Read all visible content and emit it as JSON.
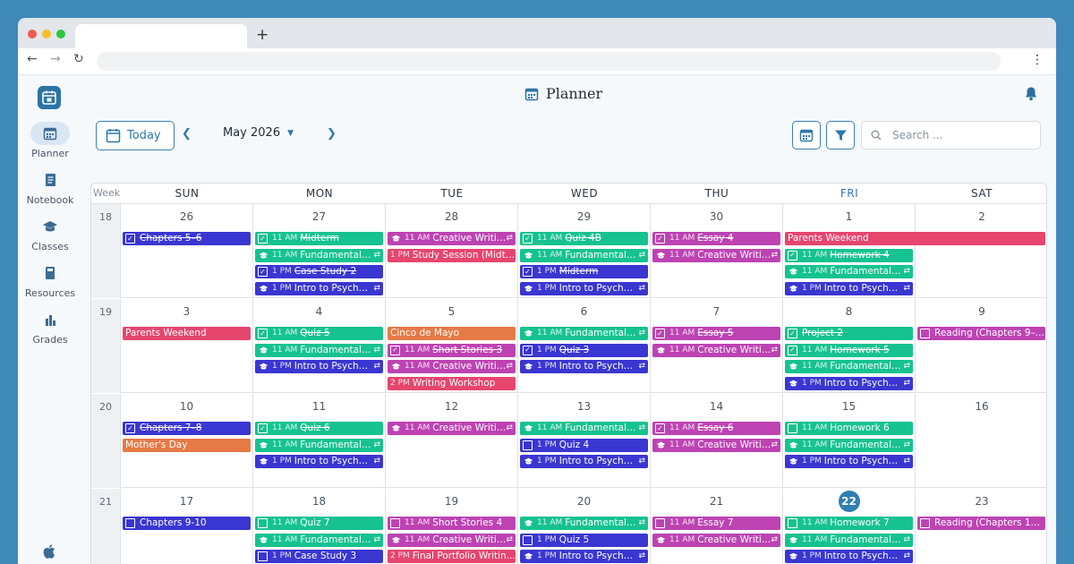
{
  "app": {
    "title": "Planner"
  },
  "sidebar": {
    "items": [
      {
        "label": "Planner",
        "icon": "calendar-icon",
        "active": true
      },
      {
        "label": "Notebook",
        "icon": "notebook-icon",
        "active": false
      },
      {
        "label": "Classes",
        "icon": "graduation-cap-icon",
        "active": false
      },
      {
        "label": "Resources",
        "icon": "book-icon",
        "active": false
      },
      {
        "label": "Grades",
        "icon": "bar-chart-icon",
        "active": false
      }
    ]
  },
  "controls": {
    "today_label": "Today",
    "month_label": "May 2026",
    "search_placeholder": "Search ..."
  },
  "calendar": {
    "week_label": "Week",
    "days": [
      "SUN",
      "MON",
      "TUE",
      "WED",
      "THU",
      "FRI",
      "SAT"
    ],
    "today_col": 5,
    "weeks": [
      {
        "num": "18",
        "dates": [
          "26",
          "27",
          "28",
          "29",
          "30",
          "1",
          "2"
        ]
      },
      {
        "num": "19",
        "dates": [
          "3",
          "4",
          "5",
          "6",
          "7",
          "8",
          "9"
        ]
      },
      {
        "num": "20",
        "dates": [
          "10",
          "11",
          "12",
          "13",
          "14",
          "15",
          "16"
        ]
      },
      {
        "num": "21",
        "dates": [
          "17",
          "18",
          "19",
          "20",
          "21",
          "22",
          "23"
        ]
      }
    ],
    "today_date": "22"
  },
  "events": [
    {
      "w": 0,
      "d": 0,
      "row": 0,
      "label": "Chapters 5–6",
      "time": "",
      "color": "blue",
      "kind": "task",
      "done": true
    },
    {
      "w": 0,
      "d": 1,
      "row": 0,
      "label": "Midterm",
      "time": "11 AM",
      "color": "green",
      "kind": "task",
      "done": true
    },
    {
      "w": 0,
      "d": 1,
      "row": 1,
      "label": "Fundamentals ...",
      "time": "11 AM",
      "color": "green",
      "kind": "class",
      "done": false,
      "repeat": true
    },
    {
      "w": 0,
      "d": 1,
      "row": 2,
      "label": "Case Study 2",
      "time": "1 PM",
      "color": "blue",
      "kind": "task",
      "done": true
    },
    {
      "w": 0,
      "d": 1,
      "row": 3,
      "label": "Intro to Psychol...",
      "time": "1 PM",
      "color": "blue",
      "kind": "class",
      "done": false,
      "repeat": true
    },
    {
      "w": 0,
      "d": 2,
      "row": 0,
      "label": "Creative Writin...",
      "time": "11 AM",
      "color": "purple",
      "kind": "class",
      "done": false,
      "repeat": true
    },
    {
      "w": 0,
      "d": 2,
      "row": 1,
      "label": "Study Session (Midte...",
      "time": "1 PM",
      "color": "pink",
      "kind": "event",
      "done": false
    },
    {
      "w": 0,
      "d": 3,
      "row": 0,
      "label": "Quiz 4B",
      "time": "11 AM",
      "color": "green",
      "kind": "task",
      "done": true
    },
    {
      "w": 0,
      "d": 3,
      "row": 1,
      "label": "Fundamentals ...",
      "time": "11 AM",
      "color": "green",
      "kind": "class",
      "done": false,
      "repeat": true
    },
    {
      "w": 0,
      "d": 3,
      "row": 2,
      "label": "Midterm",
      "time": "1 PM",
      "color": "blue",
      "kind": "task",
      "done": true
    },
    {
      "w": 0,
      "d": 3,
      "row": 3,
      "label": "Intro to Psychol...",
      "time": "1 PM",
      "color": "blue",
      "kind": "class",
      "done": false,
      "repeat": true
    },
    {
      "w": 0,
      "d": 4,
      "row": 0,
      "label": "Essay 4",
      "time": "11 AM",
      "color": "purple",
      "kind": "task",
      "done": true
    },
    {
      "w": 0,
      "d": 4,
      "row": 1,
      "label": "Creative Writin...",
      "time": "11 AM",
      "color": "purple",
      "kind": "class",
      "done": false,
      "repeat": true
    },
    {
      "w": 0,
      "d": 5,
      "row": 0,
      "label": "Parents Weekend",
      "time": "",
      "color": "pink",
      "kind": "event",
      "done": false,
      "span": 2
    },
    {
      "w": 0,
      "d": 5,
      "row": 1,
      "label": "Homework 4",
      "time": "11 AM",
      "color": "green",
      "kind": "task",
      "done": true
    },
    {
      "w": 0,
      "d": 5,
      "row": 2,
      "label": "Fundamentals ...",
      "time": "11 AM",
      "color": "green",
      "kind": "class",
      "done": false,
      "repeat": true
    },
    {
      "w": 0,
      "d": 5,
      "row": 3,
      "label": "Intro to Psychol...",
      "time": "1 PM",
      "color": "blue",
      "kind": "class",
      "done": false,
      "repeat": true
    },
    {
      "w": 1,
      "d": 0,
      "row": 0,
      "label": "Parents Weekend",
      "time": "",
      "color": "pink",
      "kind": "event",
      "done": false
    },
    {
      "w": 1,
      "d": 1,
      "row": 0,
      "label": "Quiz 5",
      "time": "11 AM",
      "color": "green",
      "kind": "task",
      "done": true
    },
    {
      "w": 1,
      "d": 1,
      "row": 1,
      "label": "Fundamentals ...",
      "time": "11 AM",
      "color": "green",
      "kind": "class",
      "done": false,
      "repeat": true
    },
    {
      "w": 1,
      "d": 1,
      "row": 2,
      "label": "Intro to Psychol...",
      "time": "1 PM",
      "color": "blue",
      "kind": "class",
      "done": false,
      "repeat": true
    },
    {
      "w": 1,
      "d": 2,
      "row": 0,
      "label": "Cinco de Mayo",
      "time": "",
      "color": "orange",
      "kind": "event",
      "done": false
    },
    {
      "w": 1,
      "d": 2,
      "row": 1,
      "label": "Short Stories 3",
      "time": "11 AM",
      "color": "purple",
      "kind": "task",
      "done": true
    },
    {
      "w": 1,
      "d": 2,
      "row": 2,
      "label": "Creative Writin...",
      "time": "11 AM",
      "color": "purple",
      "kind": "class",
      "done": false,
      "repeat": true
    },
    {
      "w": 1,
      "d": 2,
      "row": 3,
      "label": "Writing Workshop",
      "time": "2 PM",
      "color": "pink",
      "kind": "event",
      "done": false
    },
    {
      "w": 1,
      "d": 3,
      "row": 0,
      "label": "Fundamentals ...",
      "time": "11 AM",
      "color": "green",
      "kind": "class",
      "done": false,
      "repeat": true
    },
    {
      "w": 1,
      "d": 3,
      "row": 1,
      "label": "Quiz 3",
      "time": "1 PM",
      "color": "blue",
      "kind": "task",
      "done": true
    },
    {
      "w": 1,
      "d": 3,
      "row": 2,
      "label": "Intro to Psychol...",
      "time": "1 PM",
      "color": "blue",
      "kind": "class",
      "done": false,
      "repeat": true
    },
    {
      "w": 1,
      "d": 4,
      "row": 0,
      "label": "Essay 5",
      "time": "11 AM",
      "color": "purple",
      "kind": "task",
      "done": true
    },
    {
      "w": 1,
      "d": 4,
      "row": 1,
      "label": "Creative Writin...",
      "time": "11 AM",
      "color": "purple",
      "kind": "class",
      "done": false,
      "repeat": true
    },
    {
      "w": 1,
      "d": 5,
      "row": 0,
      "label": "Project 2",
      "time": "",
      "color": "green",
      "kind": "task",
      "done": true
    },
    {
      "w": 1,
      "d": 5,
      "row": 1,
      "label": "Homework 5",
      "time": "11 AM",
      "color": "green",
      "kind": "task",
      "done": true
    },
    {
      "w": 1,
      "d": 5,
      "row": 2,
      "label": "Fundamentals ...",
      "time": "11 AM",
      "color": "green",
      "kind": "class",
      "done": false,
      "repeat": true
    },
    {
      "w": 1,
      "d": 5,
      "row": 3,
      "label": "Intro to Psychol...",
      "time": "1 PM",
      "color": "blue",
      "kind": "class",
      "done": false,
      "repeat": true
    },
    {
      "w": 1,
      "d": 6,
      "row": 0,
      "label": "Reading (Chapters 9–...",
      "time": "",
      "color": "purple",
      "kind": "task",
      "done": false
    },
    {
      "w": 2,
      "d": 0,
      "row": 0,
      "label": "Chapters 7–8",
      "time": "",
      "color": "blue",
      "kind": "task",
      "done": true
    },
    {
      "w": 2,
      "d": 0,
      "row": 1,
      "label": "Mother's Day",
      "time": "",
      "color": "orange",
      "kind": "event",
      "done": false
    },
    {
      "w": 2,
      "d": 1,
      "row": 0,
      "label": "Quiz 6",
      "time": "11 AM",
      "color": "green",
      "kind": "task",
      "done": true
    },
    {
      "w": 2,
      "d": 1,
      "row": 1,
      "label": "Fundamentals ...",
      "time": "11 AM",
      "color": "green",
      "kind": "class",
      "done": false,
      "repeat": true
    },
    {
      "w": 2,
      "d": 1,
      "row": 2,
      "label": "Intro to Psychol...",
      "time": "1 PM",
      "color": "blue",
      "kind": "class",
      "done": false,
      "repeat": true
    },
    {
      "w": 2,
      "d": 2,
      "row": 0,
      "label": "Creative Writin...",
      "time": "11 AM",
      "color": "purple",
      "kind": "class",
      "done": false,
      "repeat": true
    },
    {
      "w": 2,
      "d": 3,
      "row": 0,
      "label": "Fundamentals ...",
      "time": "11 AM",
      "color": "green",
      "kind": "class",
      "done": false,
      "repeat": true
    },
    {
      "w": 2,
      "d": 3,
      "row": 1,
      "label": "Quiz 4",
      "time": "1 PM",
      "color": "blue",
      "kind": "task",
      "done": false
    },
    {
      "w": 2,
      "d": 3,
      "row": 2,
      "label": "Intro to Psychol...",
      "time": "1 PM",
      "color": "blue",
      "kind": "class",
      "done": false,
      "repeat": true
    },
    {
      "w": 2,
      "d": 4,
      "row": 0,
      "label": "Essay 6",
      "time": "11 AM",
      "color": "purple",
      "kind": "task",
      "done": true
    },
    {
      "w": 2,
      "d": 4,
      "row": 1,
      "label": "Creative Writin...",
      "time": "11 AM",
      "color": "purple",
      "kind": "class",
      "done": false,
      "repeat": true
    },
    {
      "w": 2,
      "d": 5,
      "row": 0,
      "label": "Homework 6",
      "time": "11 AM",
      "color": "green",
      "kind": "task",
      "done": false
    },
    {
      "w": 2,
      "d": 5,
      "row": 1,
      "label": "Fundamentals ...",
      "time": "11 AM",
      "color": "green",
      "kind": "class",
      "done": false,
      "repeat": true
    },
    {
      "w": 2,
      "d": 5,
      "row": 2,
      "label": "Intro to Psychol...",
      "time": "1 PM",
      "color": "blue",
      "kind": "class",
      "done": false,
      "repeat": true
    },
    {
      "w": 3,
      "d": 0,
      "row": 0,
      "label": "Chapters 9-10",
      "time": "",
      "color": "blue",
      "kind": "task",
      "done": false
    },
    {
      "w": 3,
      "d": 1,
      "row": 0,
      "label": "Quiz 7",
      "time": "11 AM",
      "color": "green",
      "kind": "task",
      "done": false
    },
    {
      "w": 3,
      "d": 1,
      "row": 1,
      "label": "Fundamentals ...",
      "time": "11 AM",
      "color": "green",
      "kind": "class",
      "done": false,
      "repeat": true
    },
    {
      "w": 3,
      "d": 1,
      "row": 2,
      "label": "Case Study 3",
      "time": "1 PM",
      "color": "blue",
      "kind": "task",
      "done": false
    },
    {
      "w": 3,
      "d": 1,
      "row": 3,
      "label": "Intro to Psychol...",
      "time": "1 PM",
      "color": "blue",
      "kind": "class",
      "done": false,
      "repeat": true
    },
    {
      "w": 3,
      "d": 2,
      "row": 0,
      "label": "Short Stories 4",
      "time": "11 AM",
      "color": "purple",
      "kind": "task",
      "done": false
    },
    {
      "w": 3,
      "d": 2,
      "row": 1,
      "label": "Creative Writin...",
      "time": "11 AM",
      "color": "purple",
      "kind": "class",
      "done": false,
      "repeat": true
    },
    {
      "w": 3,
      "d": 2,
      "row": 2,
      "label": "Final Portfolio Writin...",
      "time": "2 PM",
      "color": "pink",
      "kind": "event",
      "done": false
    },
    {
      "w": 3,
      "d": 3,
      "row": 0,
      "label": "Fundamentals ...",
      "time": "11 AM",
      "color": "green",
      "kind": "class",
      "done": false,
      "repeat": true
    },
    {
      "w": 3,
      "d": 3,
      "row": 1,
      "label": "Quiz 5",
      "time": "1 PM",
      "color": "blue",
      "kind": "task",
      "done": false
    },
    {
      "w": 3,
      "d": 3,
      "row": 2,
      "label": "Intro to Psychol...",
      "time": "1 PM",
      "color": "blue",
      "kind": "class",
      "done": false,
      "repeat": true
    },
    {
      "w": 3,
      "d": 4,
      "row": 0,
      "label": "Essay 7",
      "time": "11 AM",
      "color": "purple",
      "kind": "task",
      "done": false
    },
    {
      "w": 3,
      "d": 4,
      "row": 1,
      "label": "Creative Writin...",
      "time": "11 AM",
      "color": "purple",
      "kind": "class",
      "done": false,
      "repeat": true
    },
    {
      "w": 3,
      "d": 5,
      "row": 0,
      "label": "Homework 7",
      "time": "11 AM",
      "color": "green",
      "kind": "task",
      "done": false
    },
    {
      "w": 3,
      "d": 5,
      "row": 1,
      "label": "Fundamentals ...",
      "time": "11 AM",
      "color": "green",
      "kind": "class",
      "done": false,
      "repeat": true
    },
    {
      "w": 3,
      "d": 5,
      "row": 2,
      "label": "Intro to Psychol...",
      "time": "1 PM",
      "color": "blue",
      "kind": "class",
      "done": false,
      "repeat": true
    },
    {
      "w": 3,
      "d": 6,
      "row": 0,
      "label": "Reading (Chapters 13...",
      "time": "",
      "color": "purple",
      "kind": "task",
      "done": false
    }
  ]
}
